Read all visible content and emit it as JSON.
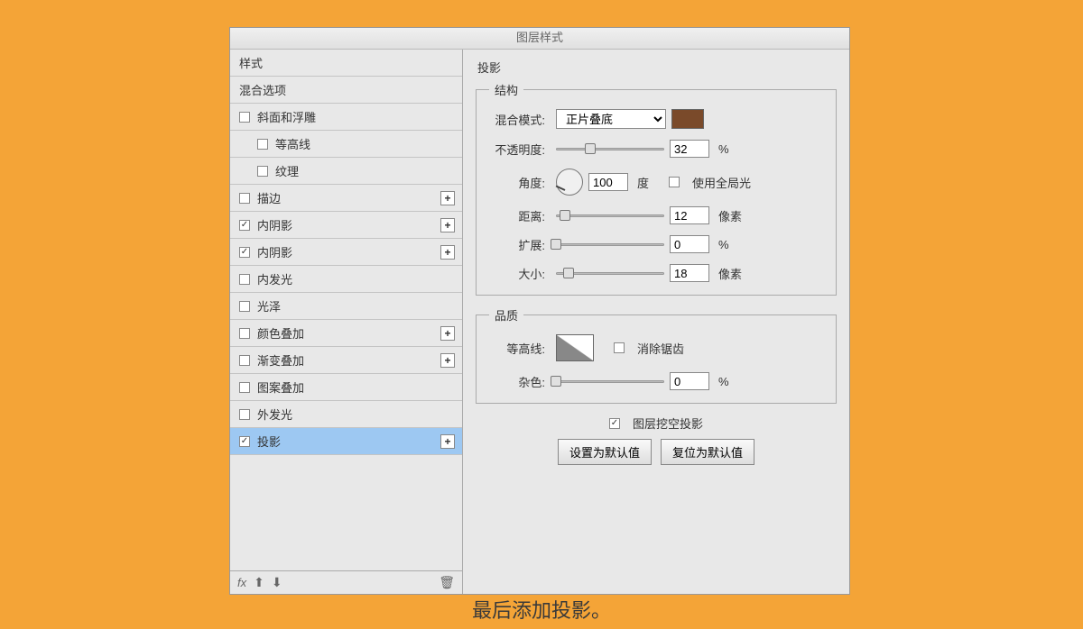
{
  "title": "图层样式",
  "section_title": "投影",
  "left": {
    "styles_label": "样式",
    "blend_options_label": "混合选项",
    "items": [
      {
        "label": "斜面和浮雕",
        "checked": false,
        "add": false,
        "indent": 0
      },
      {
        "label": "等高线",
        "checked": false,
        "add": false,
        "indent": 1
      },
      {
        "label": "纹理",
        "checked": false,
        "add": false,
        "indent": 1
      },
      {
        "label": "描边",
        "checked": false,
        "add": true,
        "indent": 0
      },
      {
        "label": "内阴影",
        "checked": true,
        "add": true,
        "indent": 0
      },
      {
        "label": "内阴影",
        "checked": true,
        "add": true,
        "indent": 0
      },
      {
        "label": "内发光",
        "checked": false,
        "add": false,
        "indent": 0
      },
      {
        "label": "光泽",
        "checked": false,
        "add": false,
        "indent": 0
      },
      {
        "label": "颜色叠加",
        "checked": false,
        "add": true,
        "indent": 0
      },
      {
        "label": "渐变叠加",
        "checked": false,
        "add": true,
        "indent": 0
      },
      {
        "label": "图案叠加",
        "checked": false,
        "add": false,
        "indent": 0
      },
      {
        "label": "外发光",
        "checked": false,
        "add": false,
        "indent": 0
      },
      {
        "label": "投影",
        "checked": true,
        "add": true,
        "indent": 0,
        "selected": true
      }
    ],
    "footer_fx": "fx"
  },
  "structure": {
    "legend": "结构",
    "blend_mode_label": "混合模式:",
    "blend_mode_value": "正片叠底",
    "color": "#7a4a2a",
    "opacity_label": "不透明度:",
    "opacity_value": "32",
    "opacity_unit": "%",
    "angle_label": "角度:",
    "angle_value": "100",
    "angle_unit": "度",
    "global_light_label": "使用全局光",
    "distance_label": "距离:",
    "distance_value": "12",
    "distance_unit": "像素",
    "spread_label": "扩展:",
    "spread_value": "0",
    "spread_unit": "%",
    "size_label": "大小:",
    "size_value": "18",
    "size_unit": "像素"
  },
  "quality": {
    "legend": "品质",
    "contour_label": "等高线:",
    "antialias_label": "消除锯齿",
    "noise_label": "杂色:",
    "noise_value": "0",
    "noise_unit": "%"
  },
  "knockout_label": "图层挖空投影",
  "btn_default": "设置为默认值",
  "btn_reset": "复位为默认值",
  "caption": "最后添加投影。"
}
